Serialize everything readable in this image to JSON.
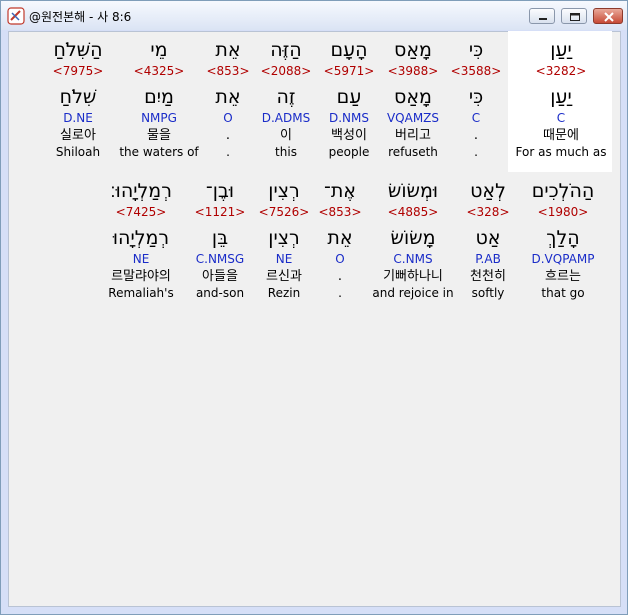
{
  "window": {
    "title": "@원전본해 - 사 8:6"
  },
  "rows": [
    {
      "words": [
        {
          "heb": "יַעַן",
          "strong": "<3282>",
          "lex": "יַעַן",
          "morph": "C",
          "kor": "때문에",
          "eng": "For as much as"
        },
        {
          "heb": "כִּי",
          "strong": "<3588>",
          "lex": "כִּי",
          "morph": "C",
          "kor": ".",
          "eng": "."
        },
        {
          "heb": "מָאַס",
          "strong": "<3988>",
          "lex": "מָאַס",
          "morph": "VQAMZS",
          "kor": "버리고",
          "eng": "refuseth"
        },
        {
          "heb": "הָעָם",
          "strong": "<5971>",
          "lex": "עַם",
          "morph": "D.NMS",
          "kor": "백성이",
          "eng": "people"
        },
        {
          "heb": "הַזֶּה",
          "strong": "<2088>",
          "lex": "זֶה",
          "morph": "D.ADMS",
          "kor": "이",
          "eng": "this"
        },
        {
          "heb": "אֵת",
          "strong": "<853>",
          "lex": "אֵת",
          "morph": "O",
          "kor": ".",
          "eng": "."
        },
        {
          "heb": "מֵי",
          "strong": "<4325>",
          "lex": "מַיִם",
          "morph": "NMPG",
          "kor": "물을",
          "eng": "the waters of"
        },
        {
          "heb": "הַשִּׁלֹחַ",
          "strong": "<7975>",
          "lex": "שִׁלֹחַ",
          "morph": "D.NE",
          "kor": "실로아",
          "eng": "Shiloah"
        }
      ]
    },
    {
      "words": [
        {
          "heb": "הַהֹלְכִים",
          "strong": "<1980>",
          "lex": "הָלַךְ",
          "morph": "D.VQPAMP",
          "kor": "흐르는",
          "eng": "that go"
        },
        {
          "heb": "לְאַט",
          "strong": "<328>",
          "lex": "אַט",
          "morph": "P.AB",
          "kor": "천천히",
          "eng": "softly"
        },
        {
          "heb": "וּמְשׂוֹשׂ",
          "strong": "<4885>",
          "lex": "מָשׂוֹשׂ",
          "morph": "C.NMS",
          "kor": "기뻐하나니",
          "eng": "and rejoice in"
        },
        {
          "heb": "אֶת־",
          "strong": "<853>",
          "lex": "אֵת",
          "morph": "O",
          "kor": ".",
          "eng": "."
        },
        {
          "heb": "רְצִין",
          "strong": "<7526>",
          "lex": "רְצִין",
          "morph": "NE",
          "kor": "르신과",
          "eng": "Rezin"
        },
        {
          "heb": "וּבֶן־",
          "strong": "<1121>",
          "lex": "בֵּן",
          "morph": "C.NMSG",
          "kor": "아들을",
          "eng": "and-son"
        },
        {
          "heb": "רְמַלְיָהוּ׃",
          "strong": "<7425>",
          "lex": "רְמַלְיָהוּ",
          "morph": "NE",
          "kor": "르말랴야의",
          "eng": "Remaliah's"
        }
      ]
    }
  ]
}
